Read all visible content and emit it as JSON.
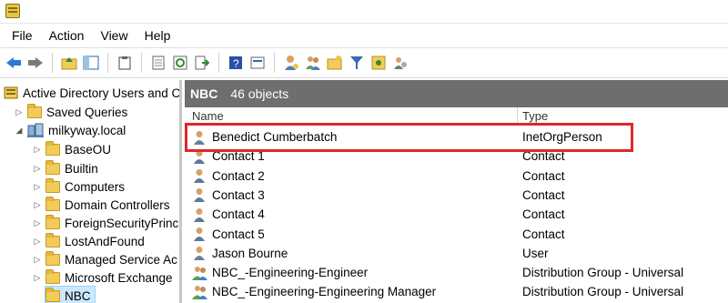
{
  "menu": [
    "File",
    "Action",
    "View",
    "Help"
  ],
  "tree": {
    "root": "Active Directory Users and C",
    "saved_queries": "Saved Queries",
    "domain": "milkyway.local",
    "ous": [
      "BaseOU",
      "Builtin",
      "Computers",
      "Domain Controllers",
      "ForeignSecurityPrinc",
      "LostAndFound",
      "Managed Service Ac",
      "Microsoft Exchange",
      "NBC"
    ]
  },
  "container": {
    "name": "NBC",
    "count": "46 objects"
  },
  "columns": {
    "name": "Name",
    "type": "Type"
  },
  "rows": [
    {
      "name": "Benedict Cumberbatch",
      "type": "InetOrgPerson",
      "icon": "user-icon"
    },
    {
      "name": "Contact 1",
      "type": "Contact",
      "icon": "contact-icon"
    },
    {
      "name": "Contact 2",
      "type": "Contact",
      "icon": "contact-icon"
    },
    {
      "name": "Contact 3",
      "type": "Contact",
      "icon": "contact-icon"
    },
    {
      "name": "Contact 4",
      "type": "Contact",
      "icon": "contact-icon"
    },
    {
      "name": "Contact 5",
      "type": "Contact",
      "icon": "contact-icon"
    },
    {
      "name": "Jason Bourne",
      "type": "User",
      "icon": "user-icon"
    },
    {
      "name": "NBC_-Engineering-Engineer",
      "type": "Distribution Group - Universal",
      "icon": "group-icon"
    },
    {
      "name": "NBC_-Engineering-Engineering Manager",
      "type": "Distribution Group - Universal",
      "icon": "group-icon"
    }
  ],
  "colors": {
    "highlight": "#e0262b",
    "header_bar": "#6e6e6e",
    "selection": "#cce8ff"
  }
}
